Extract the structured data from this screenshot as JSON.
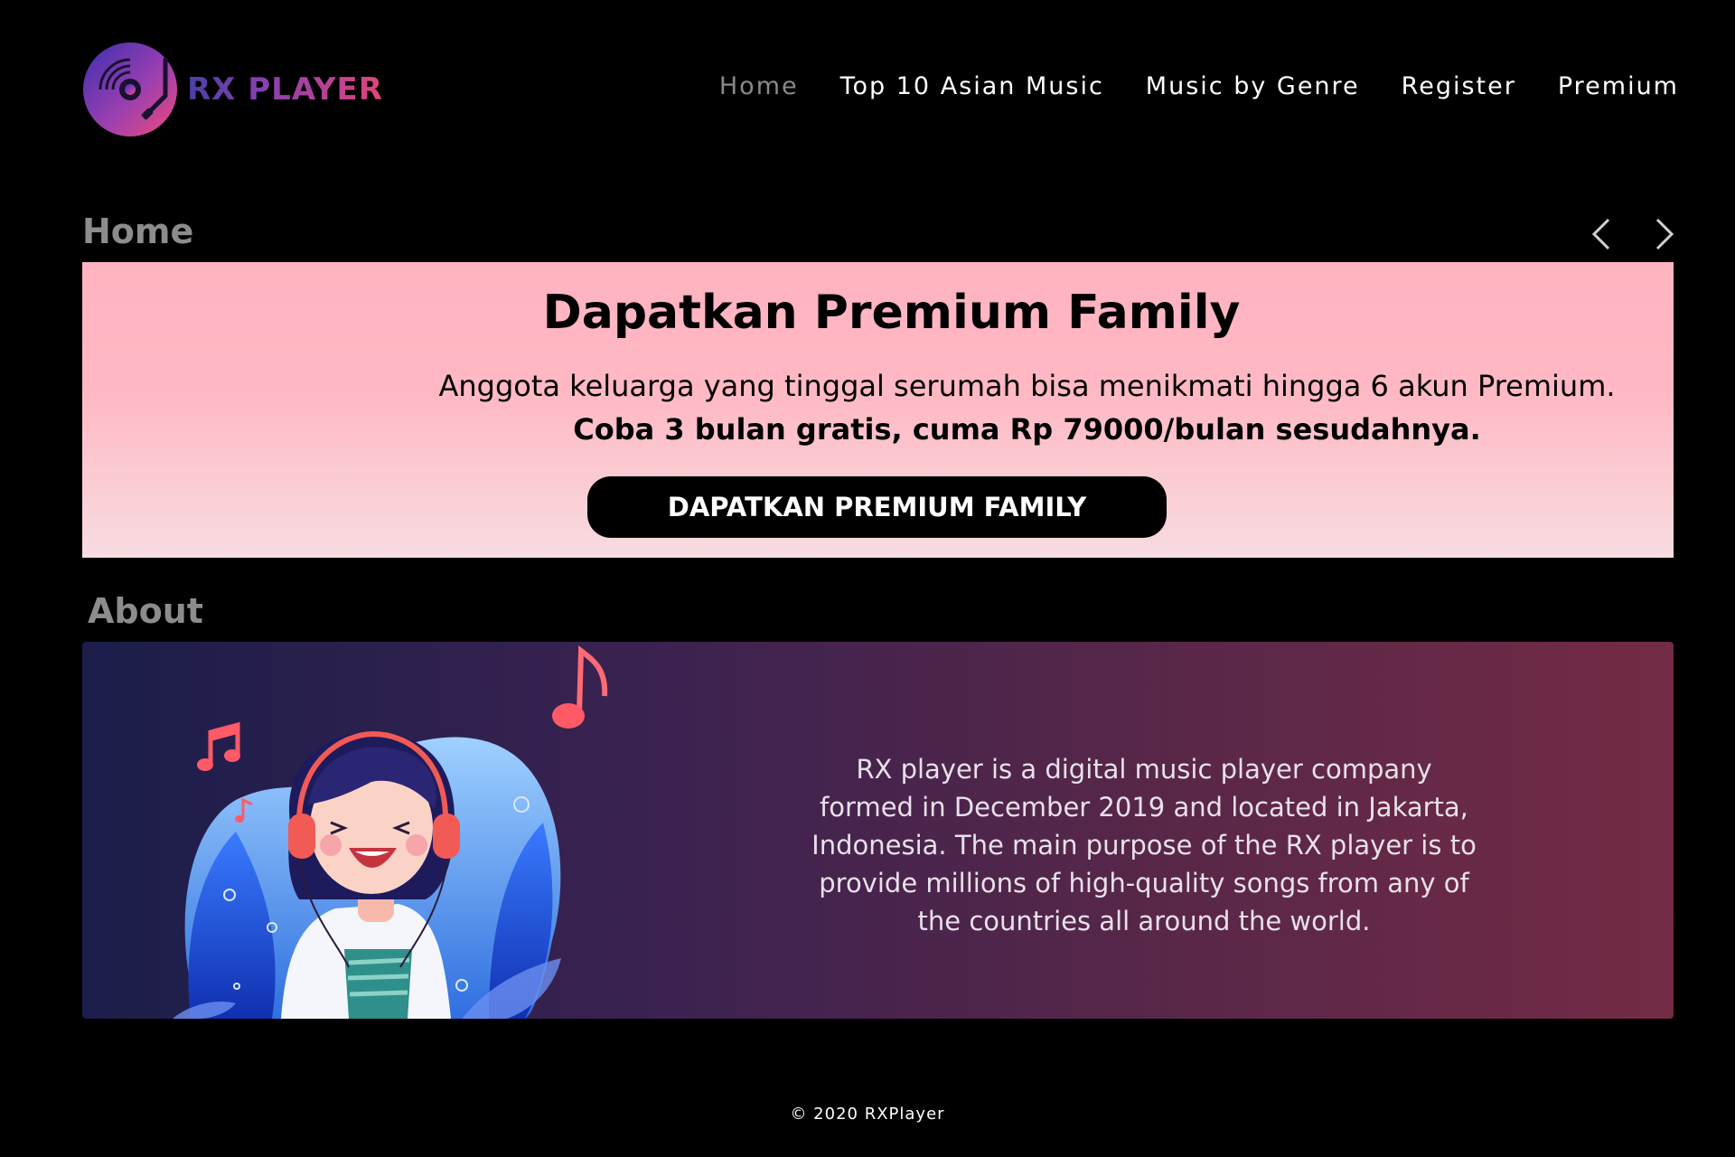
{
  "brand": {
    "name": "RX PLAYER"
  },
  "nav": {
    "items": [
      {
        "label": "Home",
        "active": true
      },
      {
        "label": "Top 10 Asian Music",
        "active": false
      },
      {
        "label": "Music by Genre",
        "active": false
      },
      {
        "label": "Register",
        "active": false
      },
      {
        "label": "Premium",
        "active": false
      }
    ]
  },
  "home": {
    "title": "Home",
    "controls": {
      "prev_icon": "chevron-left-icon",
      "next_icon": "chevron-right-icon"
    },
    "banner": {
      "title": "Dapatkan Premium Family",
      "description": "Anggota keluarga yang tinggal serumah bisa menikmati hingga 6 akun Premium.",
      "offer": "Coba 3 bulan gratis, cuma Rp 79000/bulan sesudahnya.",
      "button_label": "DAPATKAN PREMIUM FAMILY",
      "gradient_top": "#ffb3c0",
      "gradient_bottom": "#f7dce1"
    }
  },
  "about": {
    "title": "About",
    "text": "RX player is a digital music player company formed in December 2019 and located in Jakarta, Indonesia. The main purpose of the RX player is to provide millions of high-quality songs from any of the countries all around the world.",
    "illustration": "girl-with-headphones-illustration",
    "gradient_left": "#1b1d4a",
    "gradient_right": "#732b46"
  },
  "footer": {
    "copyright": "© 2020 RXPlayer"
  },
  "colors": {
    "background": "#000000",
    "accent_pink": "#e0457b",
    "accent_purple": "#4a3fa5",
    "nav_active": "#8a8a8a",
    "section_title": "#8c8c8c"
  }
}
